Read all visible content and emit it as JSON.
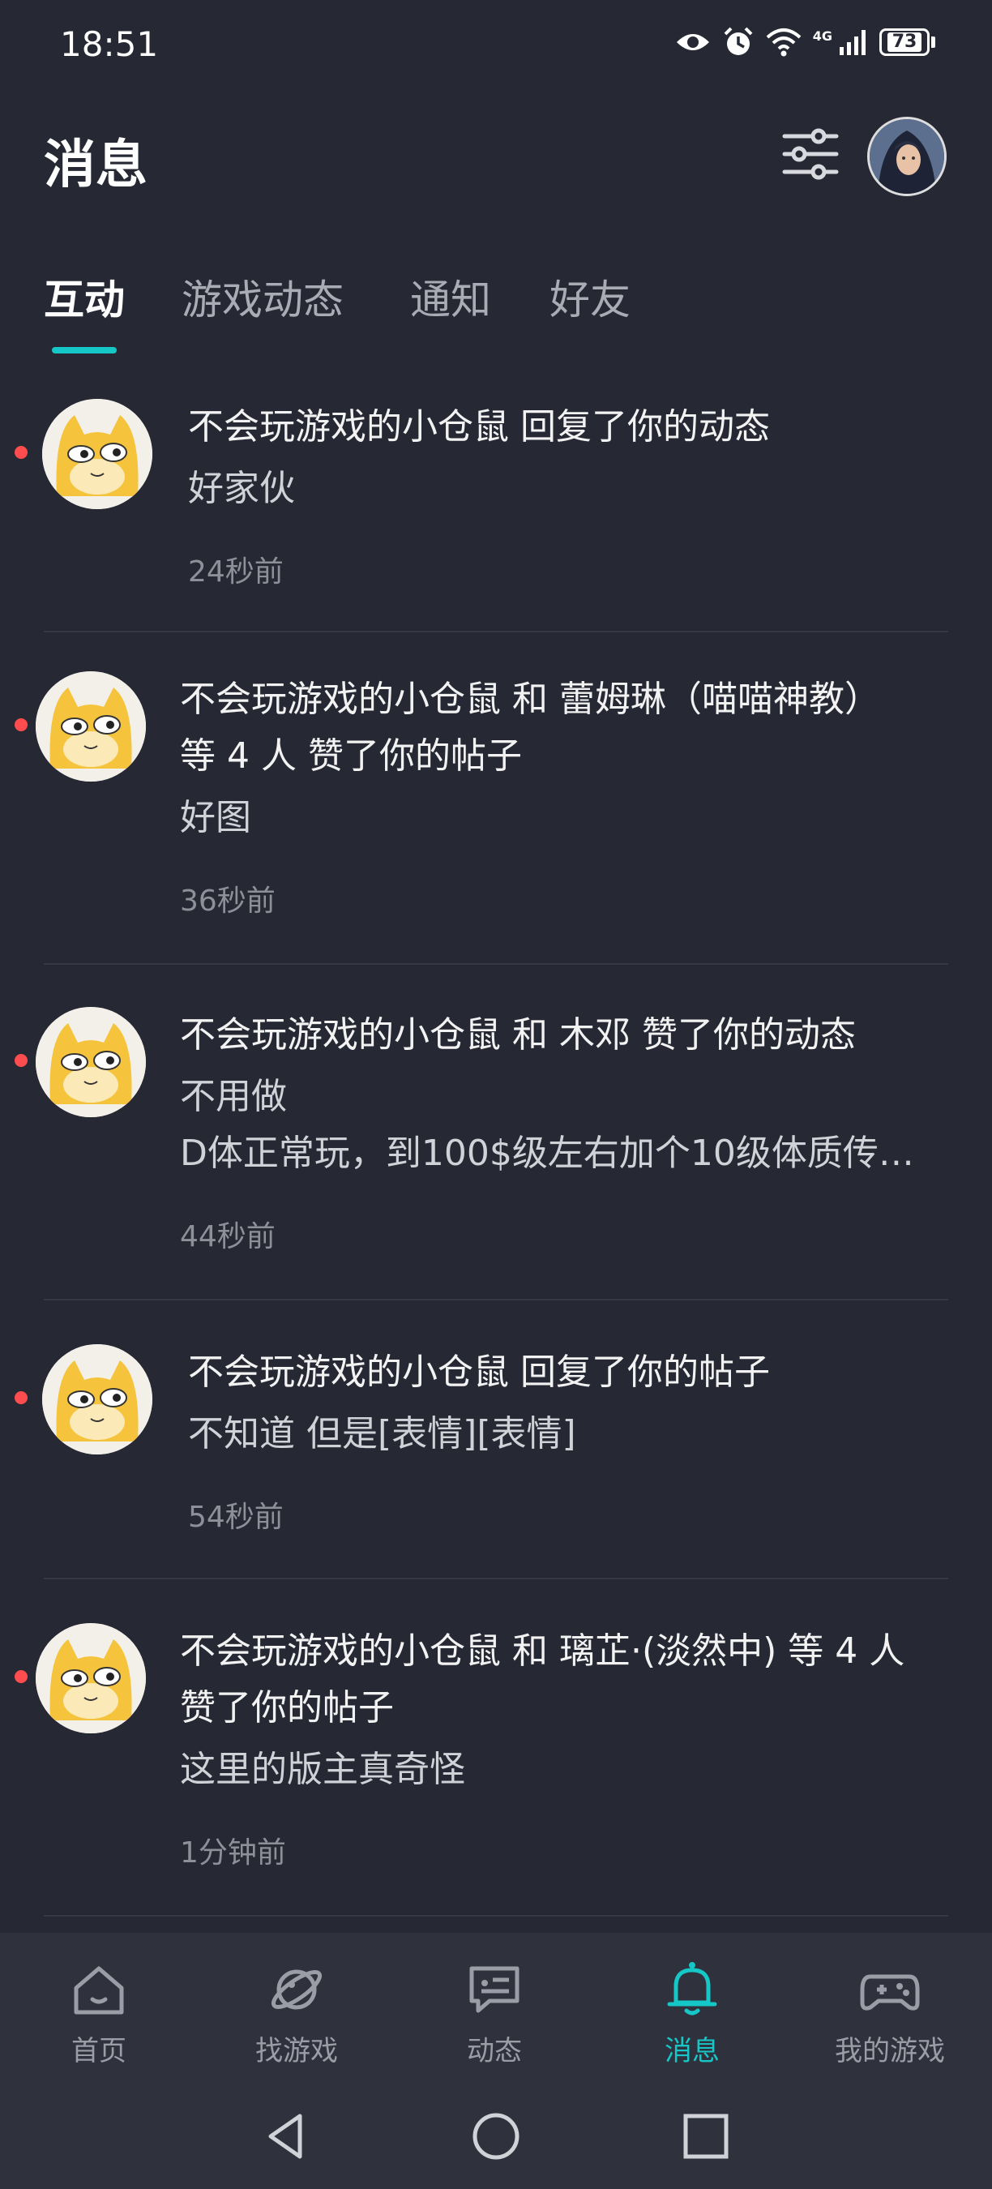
{
  "status_bar": {
    "time": "18:51",
    "network": "4G",
    "battery": "73"
  },
  "header": {
    "title": "消息",
    "filter_icon": "sliders-icon"
  },
  "tabs": [
    {
      "label": "互动",
      "active": true
    },
    {
      "label": "游戏动态",
      "active": false
    },
    {
      "label": "通知",
      "active": false
    },
    {
      "label": "好友",
      "active": false
    }
  ],
  "messages": [
    {
      "line1": "不会玩游戏的小仓鼠 回复了你的动态",
      "line2": "好家伙",
      "time": "24秒前",
      "unread": true
    },
    {
      "line1": "不会玩游戏的小仓鼠 和 蕾姆琳（喵喵神教）",
      "line2": "等 4 人 赞了你的帖子",
      "line3": "好图",
      "time": "36秒前",
      "unread": true
    },
    {
      "line1": "不会玩游戏的小仓鼠 和 木邓 赞了你的动态",
      "line2": "不用做",
      "line3": "D体正常玩，到100$级左右加个10级体质传…",
      "time": "44秒前",
      "unread": true
    },
    {
      "line1": "不会玩游戏的小仓鼠 回复了你的帖子",
      "line2": "不知道 但是[表情][表情]",
      "time": "54秒前",
      "unread": true
    },
    {
      "line1": "不会玩游戏的小仓鼠 和 璃芷·(淡然中) 等 4 人",
      "line2": "赞了你的帖子",
      "line3": "这里的版主真奇怪",
      "time": "1分钟前",
      "unread": true
    }
  ],
  "bottom_nav": [
    {
      "label": "首页",
      "icon": "home-icon",
      "active": false
    },
    {
      "label": "找游戏",
      "icon": "planet-icon",
      "active": false
    },
    {
      "label": "动态",
      "icon": "chat-bubble-icon",
      "active": false
    },
    {
      "label": "消息",
      "icon": "bell-icon",
      "active": true
    },
    {
      "label": "我的游戏",
      "icon": "gamepad-icon",
      "active": false
    }
  ],
  "colors": {
    "background": "#262833",
    "accent": "#16c7c7",
    "unread": "#ff4d4f",
    "nav_bg": "#2f313d"
  }
}
